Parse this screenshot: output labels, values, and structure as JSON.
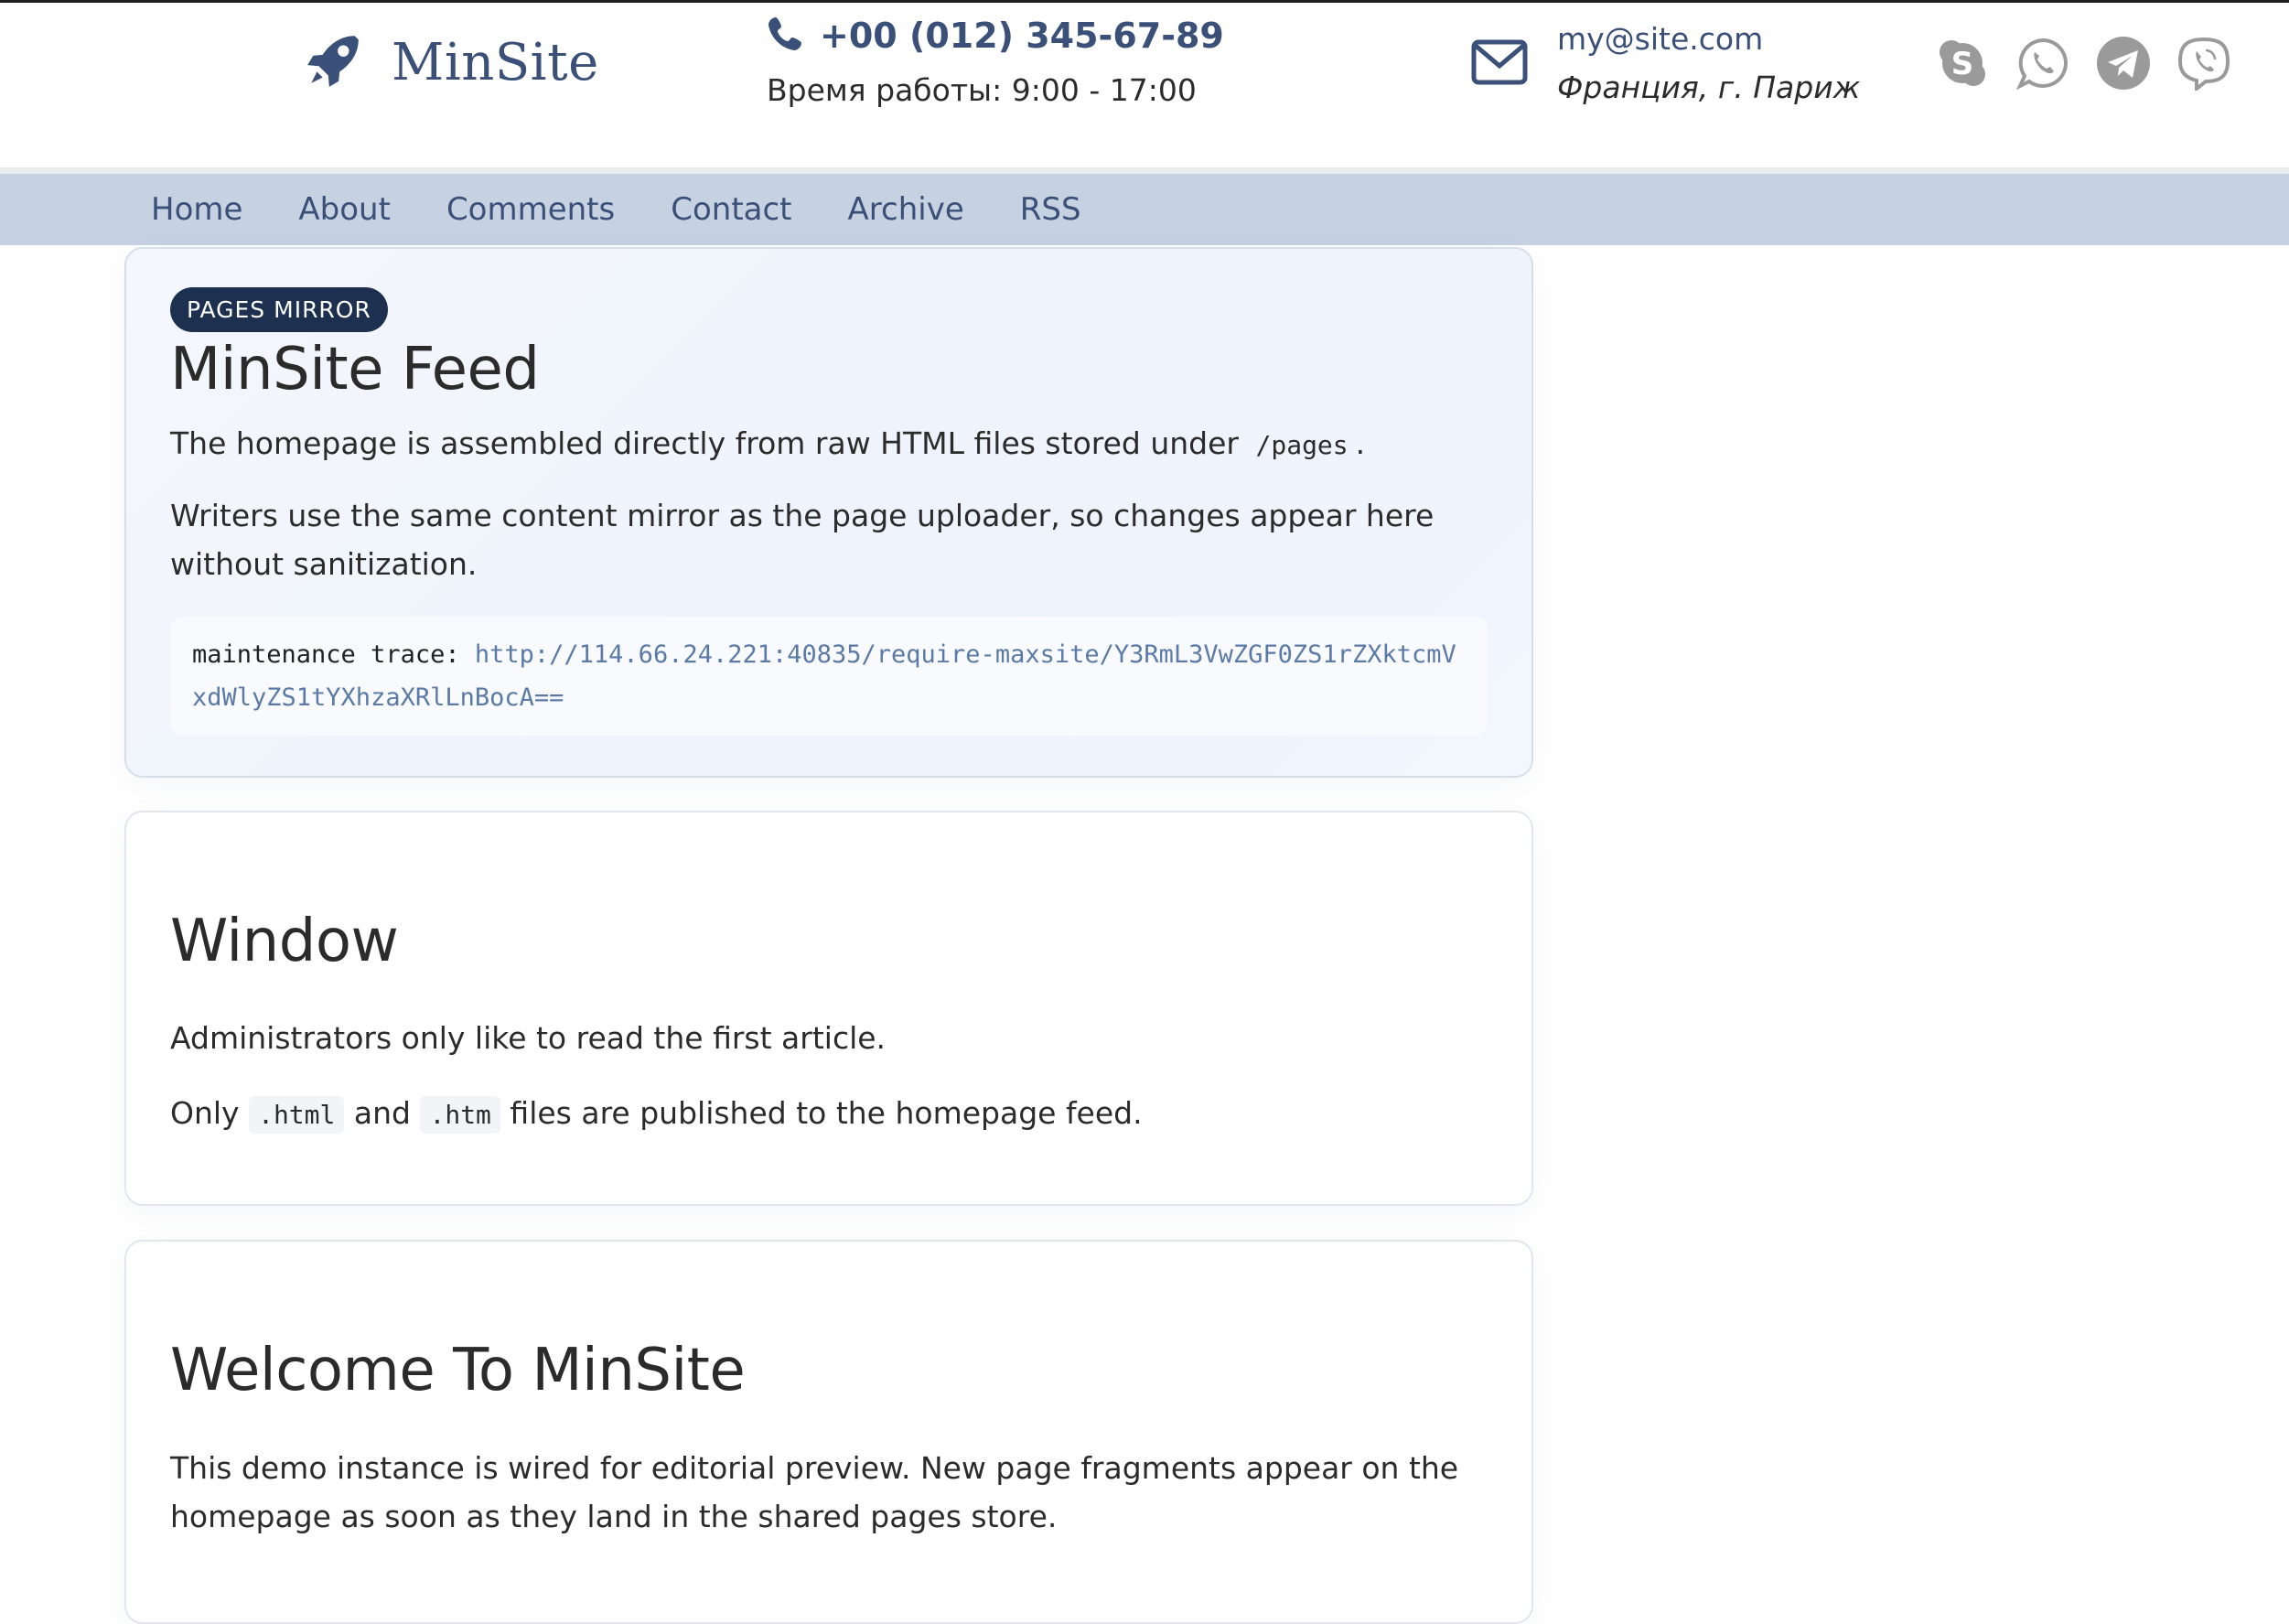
{
  "header": {
    "logo_text": "MinSite",
    "phone": "+00 (012) 345-67-89",
    "hours": "Время работы: 9:00 - 17:00",
    "email": "my@site.com",
    "location": "Франция, г. Париж",
    "socials": [
      "skype-icon",
      "whatsapp-icon",
      "telegram-icon",
      "viber-icon"
    ]
  },
  "nav": {
    "items": [
      "Home",
      "About",
      "Comments",
      "Contact",
      "Archive",
      "RSS"
    ]
  },
  "hero": {
    "badge": "PAGES MIRROR",
    "title": "MinSite Feed",
    "p1_before": "The homepage is assembled directly from raw HTML files stored under",
    "p1_code": "/pages",
    "p1_after": ".",
    "p2": "Writers use the same content mirror as the page uploader, so changes appear here without sanitization.",
    "trace_label": "maintenance trace:",
    "trace_url": "http://114.66.24.221:40835/require-maxsite/Y3RmL3VwZGF0ZS1rZXktcmVxdWlyZS1tYXhzaXRlLnBocA=="
  },
  "window_card": {
    "title": "Window",
    "p1": "Administrators only like to read the first article.",
    "p2_before": "Only",
    "p2_code1": ".html",
    "p2_mid": "and",
    "p2_code2": ".htm",
    "p2_after": "files are published to the homepage feed."
  },
  "welcome_card": {
    "title": "Welcome To MinSite",
    "p1": "This demo instance is wired for editorial preview. New page fragments appear on the homepage as soon as they land in the shared pages store."
  },
  "colors": {
    "brand": "#3b5078",
    "nav_bg": "#c6d2e2",
    "badge_bg": "#1d3050",
    "social_grey": "#9a9a9a"
  }
}
